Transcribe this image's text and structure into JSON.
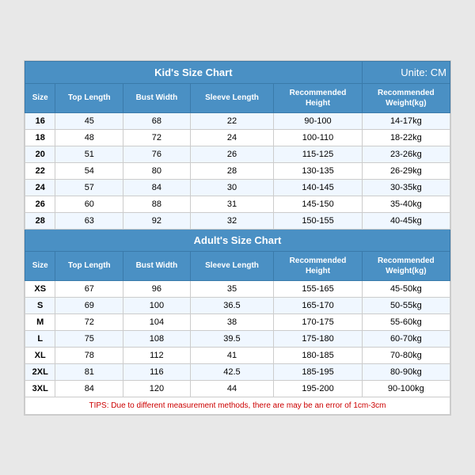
{
  "title": "Size Chart",
  "unit": "Unite: CM",
  "kids": {
    "section_label": "Kid's Size Chart",
    "headers": [
      "Size",
      "Top Length",
      "Bust Width",
      "Sleeve Length",
      "Recommended Height",
      "Recommended Weight(kg)"
    ],
    "rows": [
      [
        "16",
        "45",
        "68",
        "22",
        "90-100",
        "14-17kg"
      ],
      [
        "18",
        "48",
        "72",
        "24",
        "100-110",
        "18-22kg"
      ],
      [
        "20",
        "51",
        "76",
        "26",
        "115-125",
        "23-26kg"
      ],
      [
        "22",
        "54",
        "80",
        "28",
        "130-135",
        "26-29kg"
      ],
      [
        "24",
        "57",
        "84",
        "30",
        "140-145",
        "30-35kg"
      ],
      [
        "26",
        "60",
        "88",
        "31",
        "145-150",
        "35-40kg"
      ],
      [
        "28",
        "63",
        "92",
        "32",
        "150-155",
        "40-45kg"
      ]
    ]
  },
  "adults": {
    "section_label": "Adult's Size Chart",
    "headers": [
      "Size",
      "Top Length",
      "Bust Width",
      "Sleeve Length",
      "Recommended Height",
      "Recommended Weight(kg)"
    ],
    "rows": [
      [
        "XS",
        "67",
        "96",
        "35",
        "155-165",
        "45-50kg"
      ],
      [
        "S",
        "69",
        "100",
        "36.5",
        "165-170",
        "50-55kg"
      ],
      [
        "M",
        "72",
        "104",
        "38",
        "170-175",
        "55-60kg"
      ],
      [
        "L",
        "75",
        "108",
        "39.5",
        "175-180",
        "60-70kg"
      ],
      [
        "XL",
        "78",
        "112",
        "41",
        "180-185",
        "70-80kg"
      ],
      [
        "2XL",
        "81",
        "116",
        "42.5",
        "185-195",
        "80-90kg"
      ],
      [
        "3XL",
        "84",
        "120",
        "44",
        "195-200",
        "90-100kg"
      ]
    ]
  },
  "tips": "TIPS: Due to different measurement methods, there are may be an error of 1cm-3cm"
}
